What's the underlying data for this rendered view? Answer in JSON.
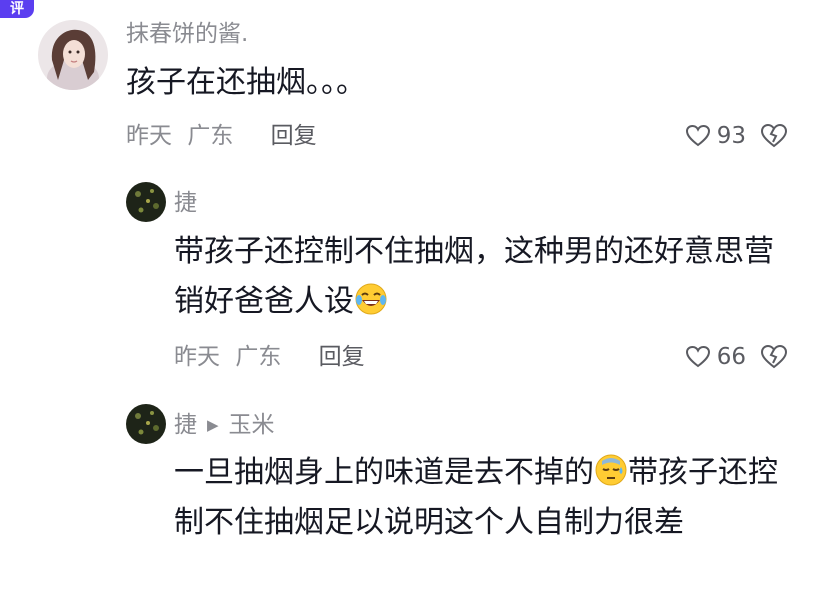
{
  "app": {
    "badge_text": "评"
  },
  "comments": [
    {
      "username": "抹春饼的酱.",
      "text": "孩子在还抽烟。。。",
      "time": "昨天",
      "location": "广东",
      "reply_label": "回复",
      "likes": "93"
    },
    {
      "username": "捷",
      "text_before_emoji": "带孩子还控制不住抽烟，这种男的还好意思营销好爸爸人设",
      "emoji": "laughing-tears-emoji",
      "time": "昨天",
      "location": "广东",
      "reply_label": "回复",
      "likes": "66"
    },
    {
      "username": "捷",
      "reply_to": "玉米",
      "text_before_emoji": "一旦抽烟身上的味道是去不掉的",
      "emoji": "sweat-emoji",
      "text_after_emoji": "带孩子还控制不住抽烟足以说明这个人自制力很差"
    }
  ],
  "colors": {
    "primary_text": "#161823",
    "secondary_text": "#8a8b91",
    "badge": "#5b3ef0"
  }
}
